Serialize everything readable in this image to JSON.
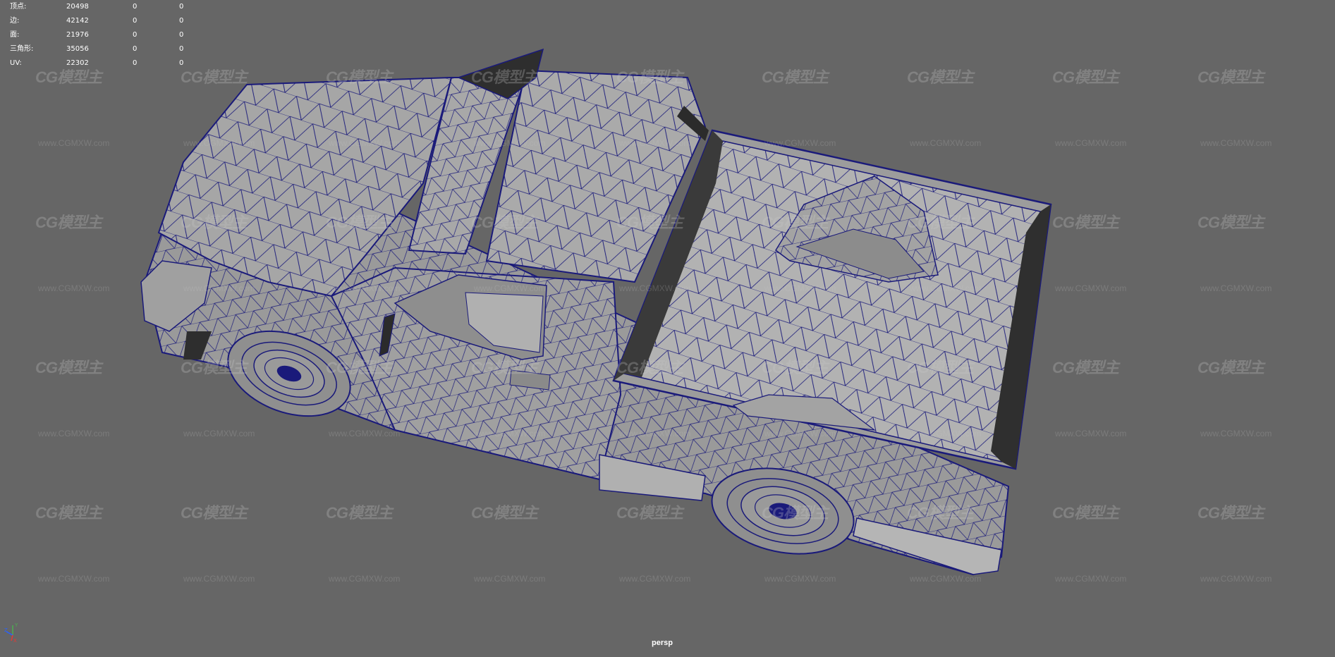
{
  "hud": {
    "rows": [
      {
        "label": "顶点:",
        "value": "20498",
        "a": "0",
        "b": "0"
      },
      {
        "label": "边:",
        "value": "42142",
        "a": "0",
        "b": "0"
      },
      {
        "label": "面:",
        "value": "21976",
        "a": "0",
        "b": "0"
      },
      {
        "label": "三角形:",
        "value": "35056",
        "a": "0",
        "b": "0"
      },
      {
        "label": "UV:",
        "value": "22302",
        "a": "0",
        "b": "0"
      }
    ]
  },
  "camera_label": "persp",
  "watermark": {
    "logo": "CG模型主",
    "url": "www.CGMXW.com"
  },
  "colors": {
    "viewport_bg": "#666666",
    "wireframe": "#1a1a7a",
    "shaded_surface": "#a9a9a9"
  },
  "gizmo_axes": {
    "x": "X",
    "y": "Y",
    "z": "Z"
  }
}
